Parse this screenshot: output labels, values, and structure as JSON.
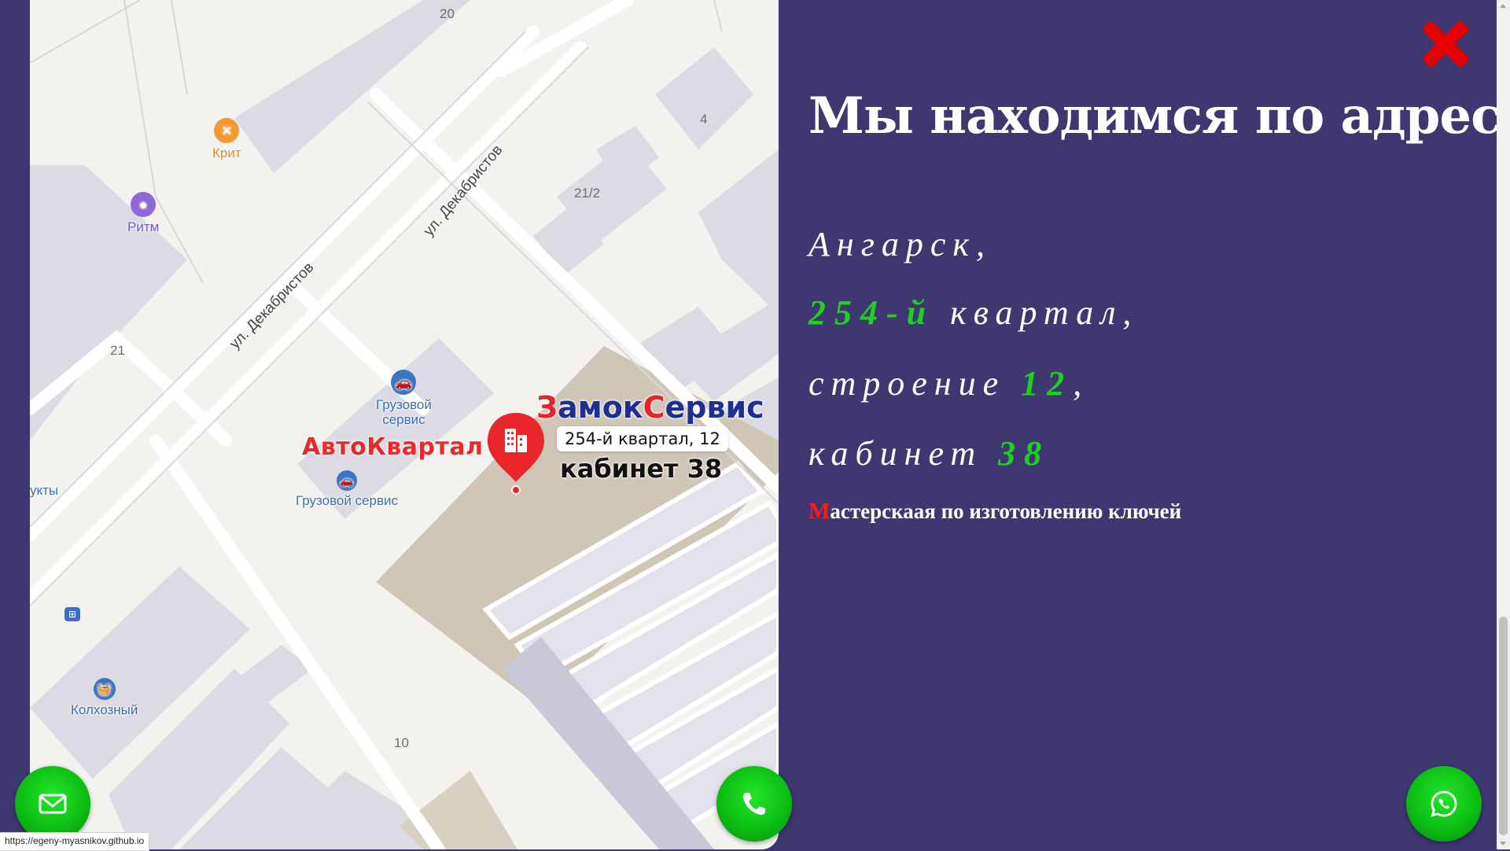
{
  "map": {
    "pois": {
      "krit": "Крит",
      "ritm": "Ритм",
      "truck_service_1": "Грузовой\nсервис",
      "truck_service_2": "Грузовой сервис",
      "kolkhozny": "Колхозный",
      "partial": "укты"
    },
    "streets": {
      "street_1": "ул. Декабристов",
      "street_2": "ул. Декабристов"
    },
    "building_numbers": {
      "b20": "20",
      "b4": "4",
      "b21_2": "21/2",
      "b21": "21",
      "b10": "10"
    },
    "brand_avto": "АвтоКвартал",
    "brand_zamok": {
      "cap1": "З",
      "part1": "амок",
      "cap2": "С",
      "part2": "ервис"
    },
    "address_bubble": "254-й квартал, 12",
    "cabinet_label": "кабинет 38"
  },
  "info": {
    "title": "Мы находимся по адресу:",
    "line1": {
      "text": "Ангарск,"
    },
    "line2": {
      "highlight": "254-й",
      "text": " квартал,"
    },
    "line3": {
      "text": "строение ",
      "highlight": "12",
      "suffix": ","
    },
    "line4": {
      "text": "кабинет ",
      "highlight": "38"
    },
    "subtitle": {
      "first": "М",
      "rest": "астерскаая по изготовлению ключей"
    }
  },
  "buttons": {
    "mail_icon": "mail-icon",
    "phone_icon": "phone-icon",
    "whatsapp_icon": "whatsapp-icon",
    "close_icon": "close-icon"
  },
  "status_url": "https://egeny-myasnikov.github.io",
  "colors": {
    "background": "#3e3770",
    "highlight_green": "#1fd11f",
    "close_red": "#e50000",
    "fab_green": "#0cbf12",
    "brand_red": "#e5232a",
    "brand_blue": "#1d2f8f"
  }
}
